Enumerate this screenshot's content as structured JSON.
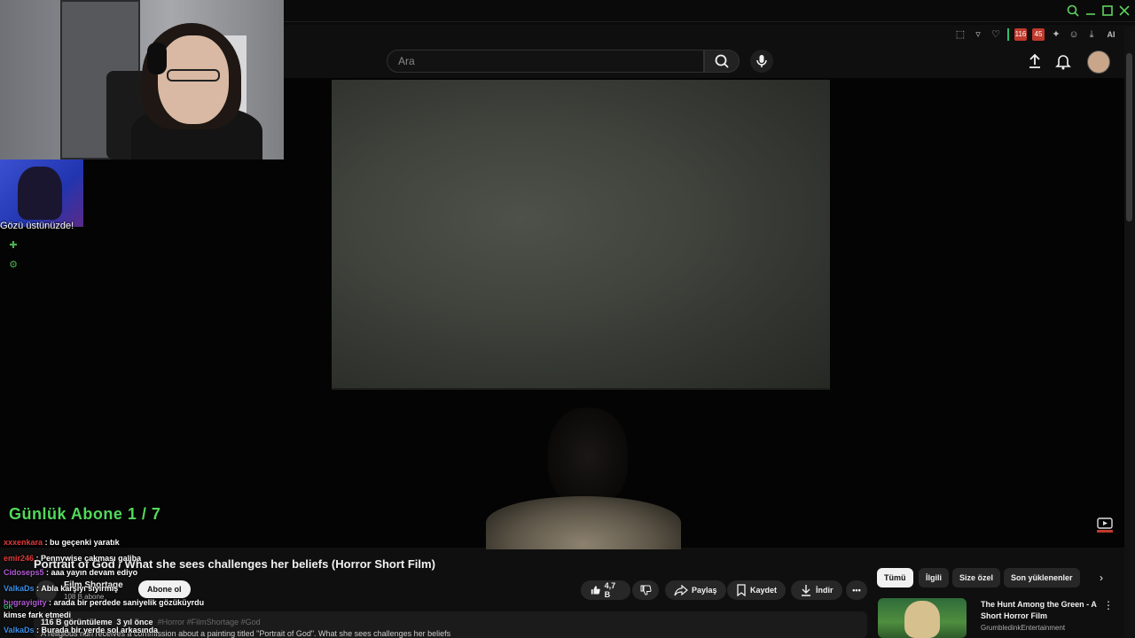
{
  "browser": {
    "window_controls": [
      "search-icon",
      "minimize-icon",
      "maximize-icon",
      "close-icon"
    ],
    "extensions": {
      "ai_label": "AI",
      "badge_1": "116",
      "badge_2": "45"
    }
  },
  "header": {
    "search_placeholder": "Ara"
  },
  "overlay": {
    "avatar_caption": "Gözü üstünüzde!",
    "daily_subs": "Günlük Abone 1 / 7",
    "chat": [
      {
        "user": "xxxenkara",
        "message": ": bu geçenki yaratık"
      },
      {
        "user": "emir246",
        "message": ": Pennywise çakması galiba"
      },
      {
        "user": "Cidoseps5",
        "message": ": aaa yayın devam ediyo"
      },
      {
        "user": "ValkaDs",
        "message": ": Abla karşıyı sıyırmış"
      },
      {
        "user": "bugrayigity",
        "message": ": arada bir perdede saniyelik gözüküyrdu"
      },
      {
        "user": "GK",
        "message": ""
      },
      {
        "user": "",
        "message": "kimse fark etmedi"
      },
      {
        "user": "ValkaDs",
        "message": ": Burada bir yerde sol arkasında"
      }
    ]
  },
  "video": {
    "title": "Portrait of God / What she sees challenges her beliefs (Horror Short Film)",
    "channel_name": "Film Shortage",
    "channel_subs": "108 B abone",
    "subscribe_label": "Abone ol",
    "likes": "4,7 B",
    "share_label": "Paylaş",
    "save_label": "Kaydet",
    "download_label": "İndir",
    "views": "116 B görüntüleme",
    "age": "3 yıl önce",
    "tags": "#Horror #FilmShortage #God",
    "description_snippet": "A religious nun receives a commission about a painting titled \"Portrait of God\". What she sees challenges her beliefs"
  },
  "sidebar": {
    "chips": [
      "Tümü",
      "İlgili",
      "Size özel",
      "Son yüklenenler"
    ],
    "active_chip": "Tümü",
    "recommendation": {
      "title": "The Hunt Among the Green - A Short Horror Film",
      "channel": "GrumbledinkEntertainment"
    }
  },
  "colors": {
    "background": "#0f0f0f",
    "accent_green": "#52d95b",
    "chip_active": "#f1f1f1"
  }
}
